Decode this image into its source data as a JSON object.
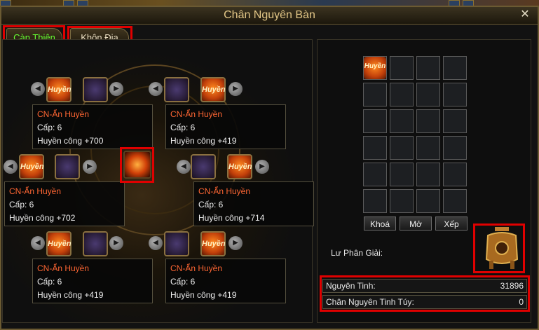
{
  "window": {
    "title": "Chân Nguyên Bàn",
    "close_label": "✕"
  },
  "tabs": [
    {
      "label": "Càn Thiên",
      "active": true
    },
    {
      "label": "Khôn Địa",
      "active": false
    }
  ],
  "slots": [
    {
      "name": "CN-Ẩn Huyền",
      "level": "Cấp: 6",
      "stat": "Huyền công +700",
      "icon": "Huyền"
    },
    {
      "name": "CN-Ẩn Huyền",
      "level": "Cấp: 6",
      "stat": "Huyền công +419",
      "icon": "Huyền"
    },
    {
      "name": "CN-Ẩn Huyền",
      "level": "Cấp: 6",
      "stat": "Huyền công +702",
      "icon": "Huyền"
    },
    {
      "name": "CN-Ẩn Huyền",
      "level": "Cấp: 6",
      "stat": "Huyền công +714",
      "icon": "Huyền"
    },
    {
      "name": "CN-Ẩn Huyền",
      "level": "Cấp: 6",
      "stat": "Huyền công +419",
      "icon": "Huyền"
    },
    {
      "name": "CN-Ẩn Huyền",
      "level": "Cấp: 6",
      "stat": "Huyền công +419",
      "icon": "Huyền"
    }
  ],
  "inventory": {
    "first_item_icon": "Huyền"
  },
  "buttons": {
    "lock": "Khoá",
    "open": "Mở",
    "sort": "Xếp"
  },
  "decompose_label": "Lư Phân Giải:",
  "stats": {
    "nguyen_tinh_label": "Nguyên Tinh:",
    "nguyen_tinh_value": "31896",
    "chan_nguyen_label": "Chân Nguyên Tinh Túy:",
    "chan_nguyen_value": "0"
  },
  "colors": {
    "accent_red": "#e00000",
    "active_tab": "#66ff33",
    "item_name": "#ff6633"
  }
}
